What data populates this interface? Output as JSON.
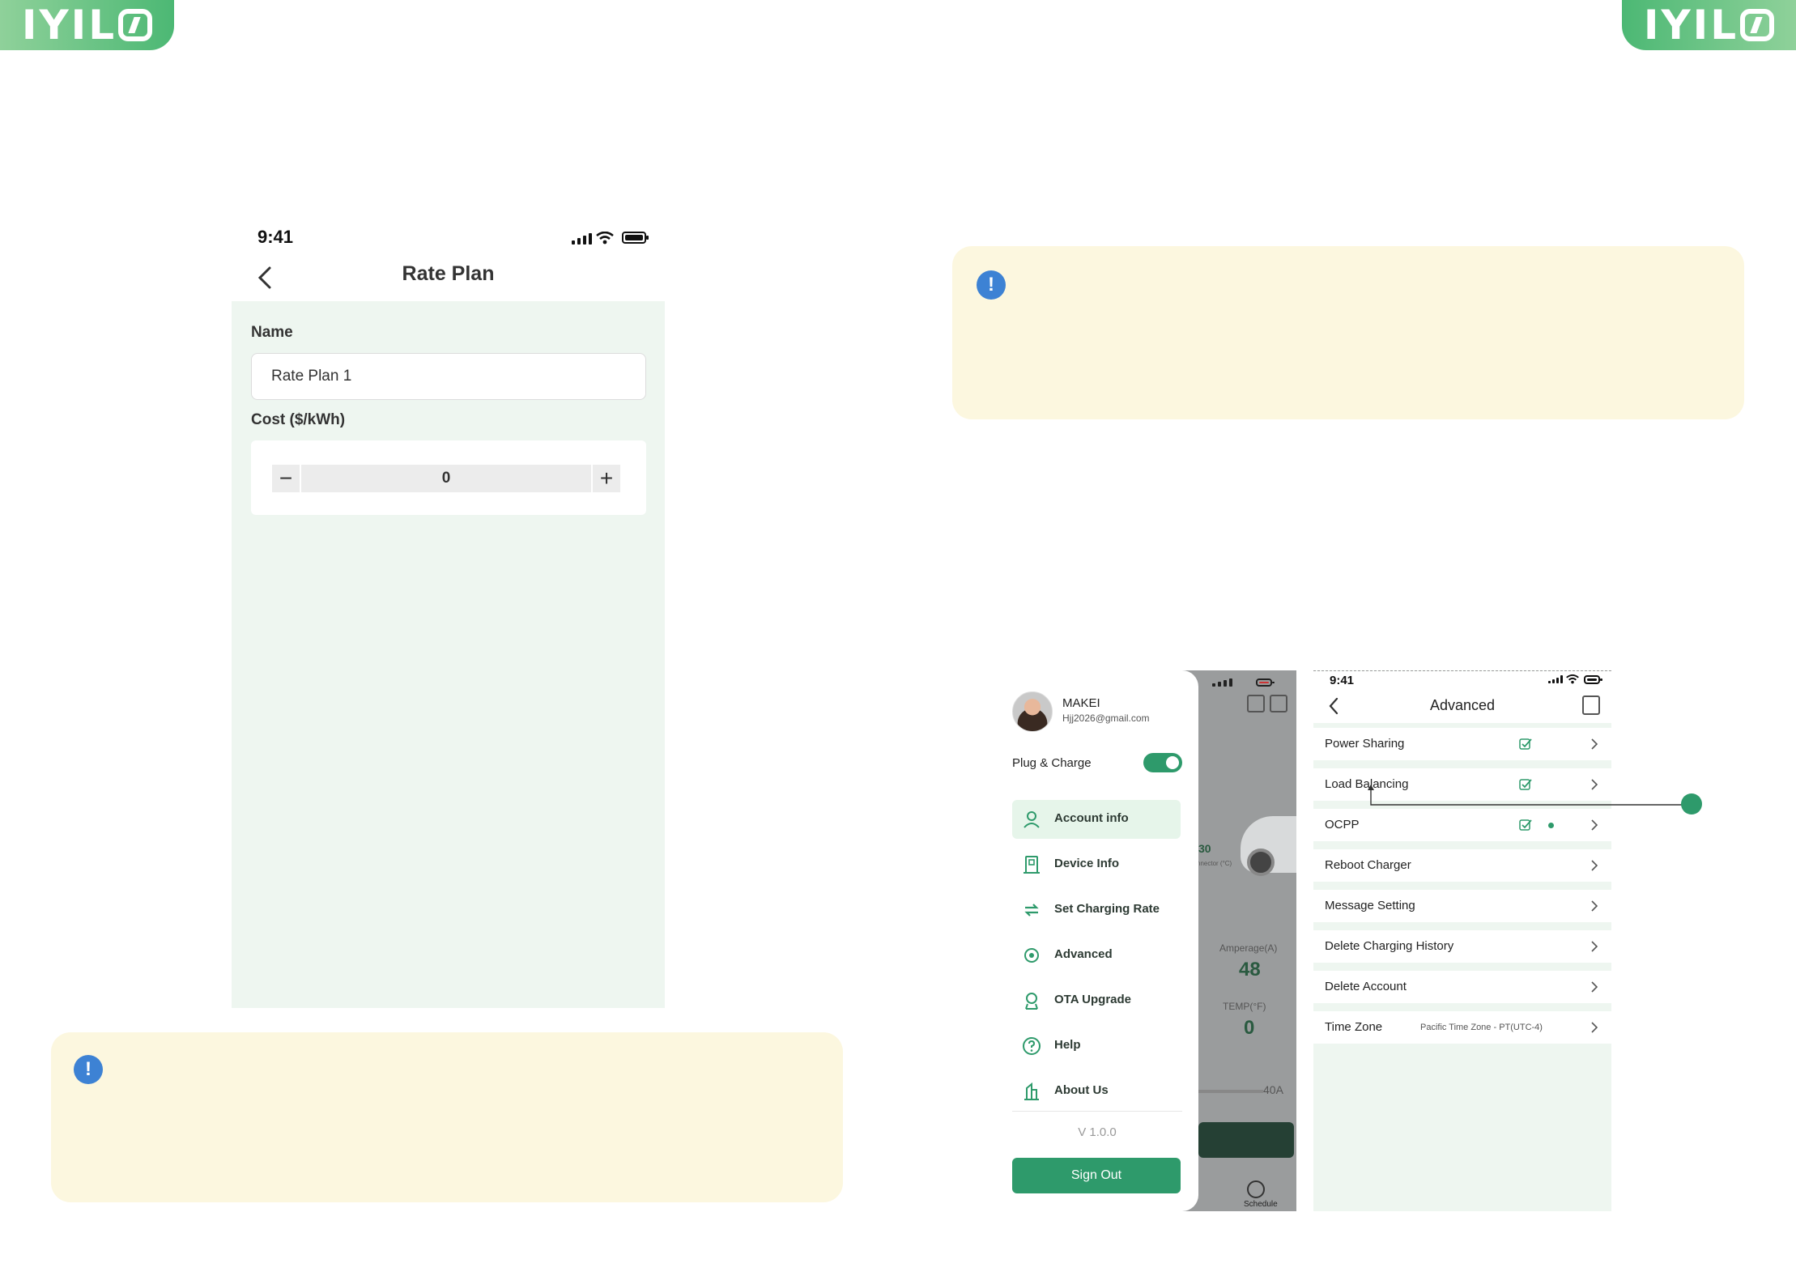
{
  "brand": {
    "logo_text": "IYIL",
    "accent": "#2e9a6b",
    "logo_green": "#4cb874"
  },
  "rate_plan": {
    "status_time": "9:41",
    "title": "Rate Plan",
    "name_label": "Name",
    "name_value": "Rate Plan 1",
    "cost_label": "Cost ($/kWh)",
    "cost_value": "0",
    "minus_symbol": "−",
    "plus_symbol": "+"
  },
  "notes": {
    "left_icon": "!",
    "right_icon": "!"
  },
  "menu": {
    "user_name": "MAKEI",
    "user_email": "Hjj2026@gmail.com",
    "plug_charge_label": "Plug & Charge",
    "plug_charge_on": true,
    "items": [
      {
        "label": "Account info",
        "icon": "person-icon",
        "active": true
      },
      {
        "label": "Device Info",
        "icon": "charger-icon",
        "active": false
      },
      {
        "label": "Set Charging Rate",
        "icon": "exchange-icon",
        "active": false
      },
      {
        "label": "Advanced",
        "icon": "advanced-icon",
        "active": false
      },
      {
        "label": "OTA Upgrade",
        "icon": "upgrade-icon",
        "active": false
      },
      {
        "label": "Help",
        "icon": "help-icon",
        "active": false
      },
      {
        "label": "About Us",
        "icon": "building-icon",
        "active": false
      }
    ],
    "version": "V 1.0.0",
    "sign_out": "Sign Out",
    "background": {
      "value_a": "30",
      "connector_text": "nnector (°C)",
      "amperage_label": "Amperage(A)",
      "amperage_value": "48",
      "temp_label": "TEMP(°F)",
      "temp_value": "0",
      "max_amp": "40A",
      "schedule_label": "Schedule"
    }
  },
  "advanced": {
    "status_time": "9:41",
    "title": "Advanced",
    "rows": [
      {
        "label": "Power Sharing",
        "value": "",
        "check": true,
        "dot": false
      },
      {
        "label": "Load Balancing",
        "value": "",
        "check": true,
        "dot": false
      },
      {
        "label": "OCPP",
        "value": "",
        "check": true,
        "dot": true
      },
      {
        "label": "Reboot Charger",
        "value": "",
        "check": false,
        "dot": false
      },
      {
        "label": "Message Setting",
        "value": "",
        "check": false,
        "dot": false
      },
      {
        "label": "Delete Charging History",
        "value": "",
        "check": false,
        "dot": false
      },
      {
        "label": "Delete Account",
        "value": "",
        "check": false,
        "dot": false
      },
      {
        "label": "Time Zone",
        "value": "Pacific Time Zone - PT(UTC-4)",
        "check": false,
        "dot": false
      }
    ]
  }
}
